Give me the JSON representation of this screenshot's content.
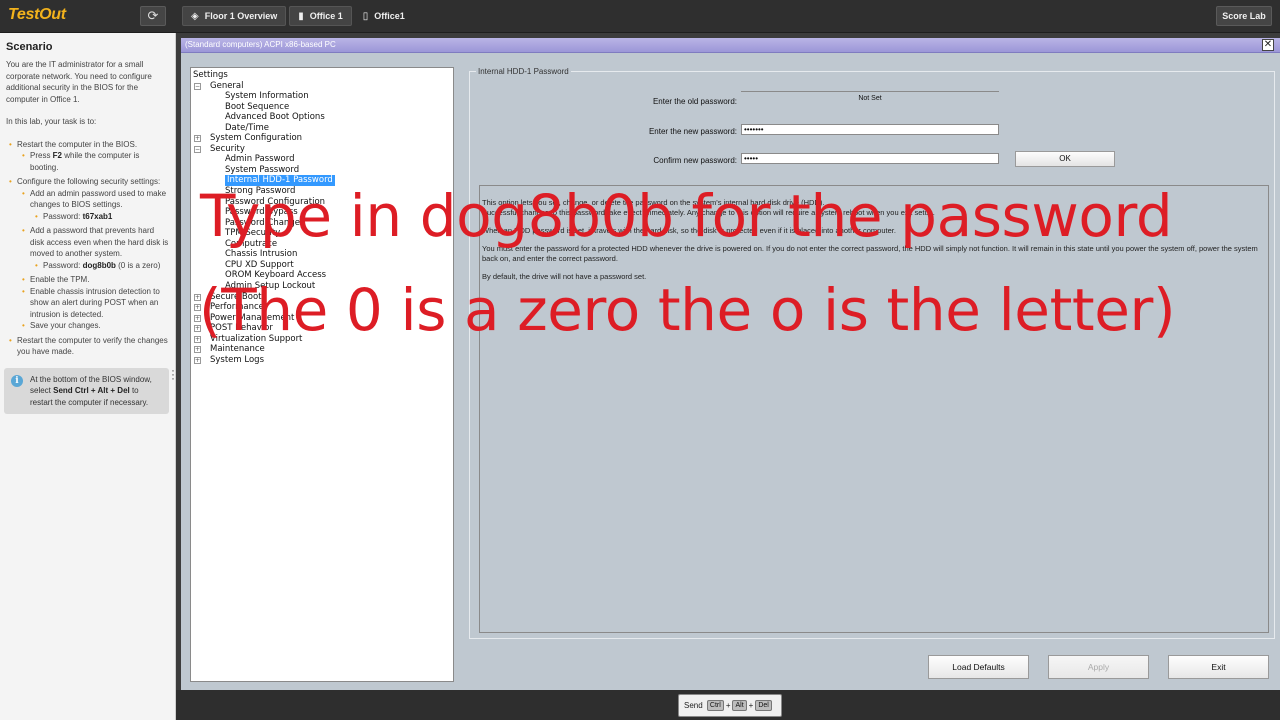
{
  "header": {
    "logo": "TestOut",
    "refresh_icon": "refresh-icon",
    "breadcrumbs": [
      {
        "label": "Floor 1 Overview",
        "icon": "layers-icon"
      },
      {
        "label": "Office 1",
        "icon": "computer-icon"
      },
      {
        "label": "Office1",
        "icon": "page-icon"
      }
    ],
    "score_label": "Score Lab"
  },
  "scenario": {
    "title": "Scenario",
    "intro": "You are the IT administrator for a small corporate network. You need to configure additional security in the BIOS for the computer in Office 1.",
    "task_intro": "In this lab, your task is to:",
    "task1": "Restart the computer in the BIOS.",
    "task1_sub_pre": "Press ",
    "task1_sub_key": "F2",
    "task1_sub_post": " while the computer is booting.",
    "task2": "Configure the following security settings:",
    "task2_a": "Add an admin password used to make changes to BIOS settings.",
    "task2_a_pw_label": "Password: ",
    "task2_a_pw": "t67xab1",
    "task2_b": "Add a password that prevents hard disk access even when the hard disk is moved to another system.",
    "task2_b_pw_label": "Password: ",
    "task2_b_pw": "dog8b0b",
    "task2_b_pw_note": " (0 is a zero)",
    "task2_c": "Enable the TPM.",
    "task2_d": "Enable chassis intrusion detection to show an alert during POST when an intrusion is detected.",
    "task2_e": "Save your changes.",
    "task3": "Restart the computer to verify the changes you have made.",
    "info_pre": "At the bottom of the BIOS window, select ",
    "info_bold": "Send Ctrl + Alt + Del",
    "info_post": " to restart the computer if necessary."
  },
  "window": {
    "title": "(Standard computers) ACPI x86-based PC",
    "close_icon": "close-icon"
  },
  "tree": {
    "root": "Settings",
    "nodes": [
      {
        "label": "General",
        "level": 1,
        "toggle": "−"
      },
      {
        "label": "System Information",
        "level": 2
      },
      {
        "label": "Boot Sequence",
        "level": 2
      },
      {
        "label": "Advanced Boot Options",
        "level": 2
      },
      {
        "label": "Date/Time",
        "level": 2
      },
      {
        "label": "System Configuration",
        "level": 1,
        "toggle": "+"
      },
      {
        "label": "Security",
        "level": 1,
        "toggle": "−"
      },
      {
        "label": "Admin Password",
        "level": 2
      },
      {
        "label": "System Password",
        "level": 2
      },
      {
        "label": "Internal HDD-1 Password",
        "level": 2,
        "selected": true
      },
      {
        "label": "Strong Password",
        "level": 2
      },
      {
        "label": "Password Configuration",
        "level": 2
      },
      {
        "label": "Password Bypass",
        "level": 2
      },
      {
        "label": "Password Change",
        "level": 2
      },
      {
        "label": "TPM Security",
        "level": 2
      },
      {
        "label": "Computrace",
        "level": 2
      },
      {
        "label": "Chassis Intrusion",
        "level": 2
      },
      {
        "label": "CPU XD Support",
        "level": 2
      },
      {
        "label": "OROM Keyboard Access",
        "level": 2
      },
      {
        "label": "Admin Setup Lockout",
        "level": 2
      },
      {
        "label": "Secure Boot",
        "level": 1,
        "toggle": "+"
      },
      {
        "label": "Performance",
        "level": 1,
        "toggle": "+"
      },
      {
        "label": "Power Management",
        "level": 1,
        "toggle": "+"
      },
      {
        "label": "POST Behavior",
        "level": 1,
        "toggle": "+"
      },
      {
        "label": "Virtualization Support",
        "level": 1,
        "toggle": "+"
      },
      {
        "label": "Maintenance",
        "level": 1,
        "toggle": "+"
      },
      {
        "label": "System Logs",
        "level": 1,
        "toggle": "+"
      }
    ]
  },
  "panel": {
    "group_title": "Internal HDD-1 Password",
    "old_label": "Enter the old password:",
    "old_value": "Not Set",
    "new_label": "Enter the new password:",
    "new_value": "•••••••",
    "confirm_label": "Confirm new password:",
    "confirm_value": "•••••",
    "ok_label": "OK",
    "desc_1": "This option lets you set, change, or delete the password on the system's internal hard disk drive (HDD).",
    "desc_1b": "Successful changes to this password take effect immediately. Any change to this option will require a system reboot when you exit setup.",
    "desc_2": "When an HDD password is set, it travels with the hard disk, so the disk is protected even if it is placed into another computer.",
    "desc_3": "You must enter the password for a protected HDD whenever the drive is powered on. If you do not enter the correct password, the HDD will simply not function. It will remain in this state until you power the system off, power the system back on, and enter the correct password.",
    "desc_4": "By default, the drive will not have a password set."
  },
  "buttons": {
    "load_defaults": "Load Defaults",
    "apply": "Apply",
    "exit": "Exit"
  },
  "footer": {
    "send": "Send",
    "key_ctrl": "Ctrl",
    "key_alt": "Alt",
    "key_del": "Del",
    "plus": "+"
  },
  "overlay": {
    "line1": "Type in dog8b0b for the password",
    "line2": "(The 0 is a zero the o is the letter)"
  }
}
